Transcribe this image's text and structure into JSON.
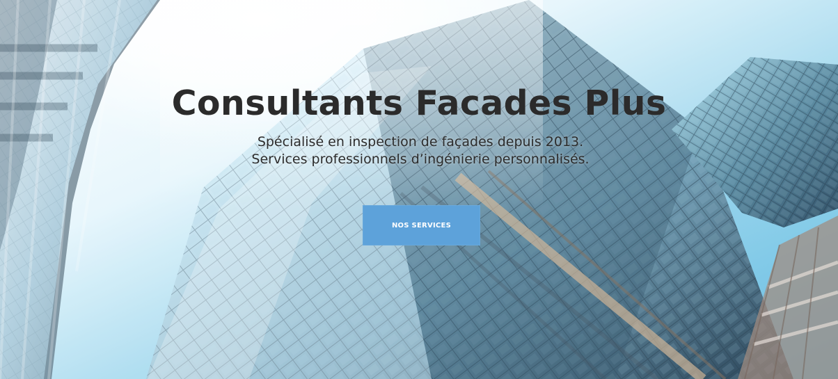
{
  "hero": {
    "title": "Consultants Facades Plus",
    "subtitle_line_1": "Spécialisé en inspection de façades depuis 2013.",
    "subtitle_line_2": "Services professionnels d’ingénierie personnalisés.",
    "button_label": "NOS SERVICES"
  },
  "colors": {
    "button": "#5da2da",
    "title_text": "#2b2b2b",
    "subtitle_text": "#2c2c2c",
    "sky": "#72c4e5"
  },
  "image": {
    "icon": "building-facade-background"
  }
}
